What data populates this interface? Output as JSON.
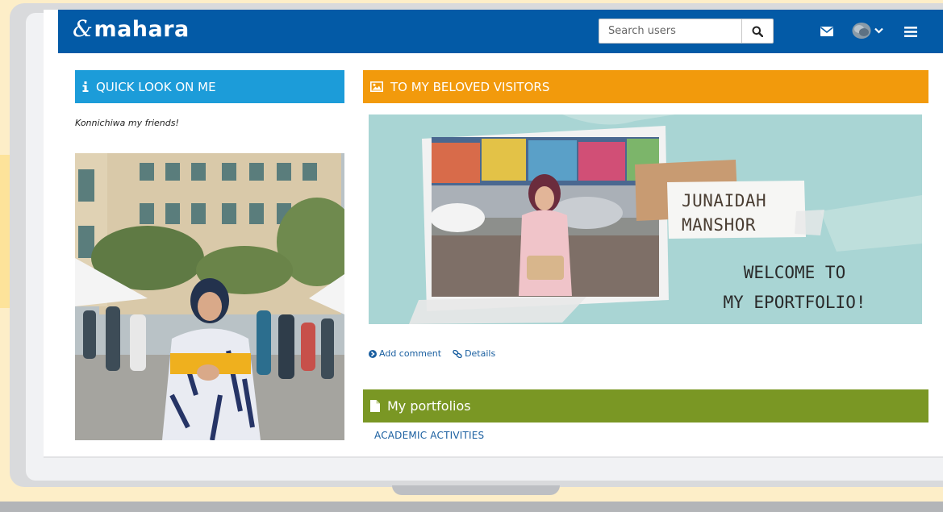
{
  "brand": {
    "name": "mahara",
    "mark": "&"
  },
  "search": {
    "placeholder": "Search users"
  },
  "nav": {
    "icons": [
      "envelope-icon",
      "avatar",
      "chevron-down-icon",
      "hamburger-menu-icon"
    ]
  },
  "blocks": {
    "quick_look": {
      "title": "QUICK LOOK ON ME",
      "icon": "info-icon",
      "text": "Konnichiwa my friends!"
    },
    "visitors": {
      "title": "TO MY BELOVED VISITORS",
      "icon": "image-icon",
      "banner": {
        "name_line1": "JUNAIDAH",
        "name_line2": "MANSHOR",
        "welcome_line1": "WELCOME TO",
        "welcome_line2": "MY EPORTFOLIO!"
      },
      "actions": {
        "add_comment": "Add comment",
        "details": "Details"
      }
    },
    "portfolios": {
      "title": "My portfolios",
      "icon": "file-icon",
      "items": [
        "ACADEMIC ACTIVITIES"
      ]
    }
  },
  "colors": {
    "topbar": "#035aa6",
    "quick_look_header": "#1c9cd9",
    "visitors_header": "#f29a0c",
    "portfolios_header": "#7a9724",
    "link": "#1a5fa0",
    "background": "#fdeec8"
  }
}
